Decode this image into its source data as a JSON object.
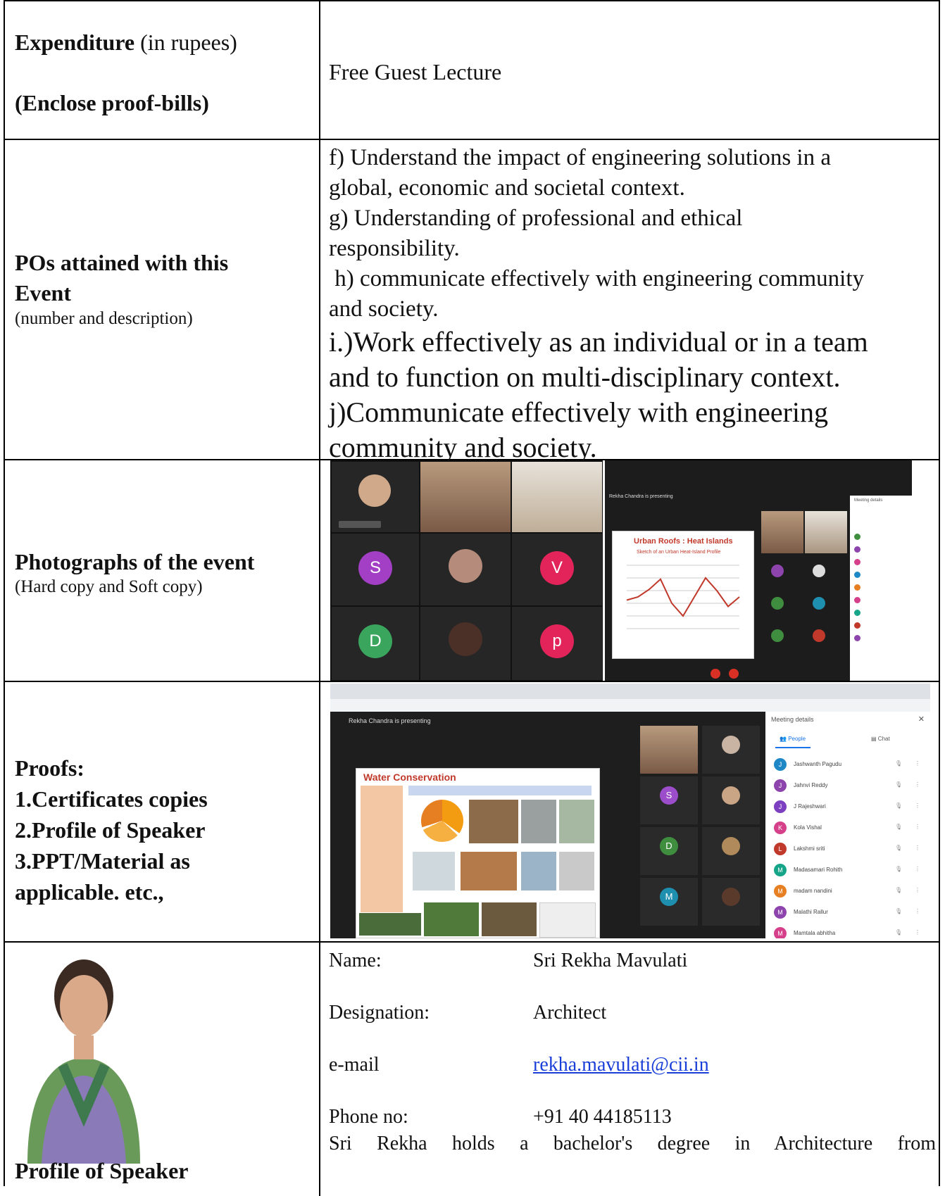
{
  "expenditure": {
    "label_bold": "Expenditure",
    "label_rest": "(in rupees)",
    "label_line2": "(Enclose proof-bills)",
    "value": "Free Guest Lecture"
  },
  "pos": {
    "label_line1": "POs attained with this",
    "label_line2": "Event",
    "label_sub": "(number and description)",
    "items": [
      "f) Understand the impact of engineering solutions in a",
      "global, economic and societal context.",
      "g) Understanding of professional and ethical",
      "responsibility.",
      " h) communicate effectively with engineering community",
      "and society."
    ],
    "items_big": [
      "i.)Work effectively as an individual or in a team",
      "and to function on multi-disciplinary context.",
      "j)Communicate effectively with engineering",
      "community and society."
    ]
  },
  "photos": {
    "label": "Photographs of the event",
    "sub": "(Hard copy and Soft copy)",
    "shot1_avatars": [
      "S",
      "V",
      "D",
      "p"
    ],
    "shot2": {
      "presenting": "Rekha Chandra is presenting",
      "slide_title": "Urban Roofs : Heat Islands",
      "slide_subtitle": "Sketch of an Urban Heat-Island Profile",
      "panel_title": "Meeting details"
    },
    "shot2_curve": [
      0.45,
      0.5,
      0.62,
      0.78,
      0.4,
      0.2,
      0.5,
      0.8,
      0.6,
      0.35,
      0.5
    ]
  },
  "proofs": {
    "title": "Proofs:",
    "items": [
      "1.Certificates copies",
      "2.Profile of Speaker",
      "3.PPT/Material as",
      "applicable. etc.,"
    ],
    "shot": {
      "presenting": "Rekha Chandra is presenting",
      "slide_title": "Water Conservation",
      "panel_title": "Meeting details",
      "people_tab": "People",
      "chat_tab": "Chat",
      "participants": [
        {
          "initial": "J",
          "name": "Jashwanth Pagudu",
          "color": "#1e88c7"
        },
        {
          "initial": "J",
          "name": "Jahnvi Reddy",
          "color": "#8e44ad"
        },
        {
          "initial": "J",
          "name": "J Rajeshwari",
          "color": "#7b3fc0"
        },
        {
          "initial": "K",
          "name": "Kola Vishal",
          "color": "#d6408a"
        },
        {
          "initial": "L",
          "name": "Lakshmi sriti",
          "color": "#c0392b"
        },
        {
          "initial": "M",
          "name": "Madasamari Rohith",
          "color": "#17a589"
        },
        {
          "initial": "M",
          "name": "madam nandini",
          "color": "#e67e22"
        },
        {
          "initial": "M",
          "name": "Malathi Rallur",
          "color": "#8e44ad"
        },
        {
          "initial": "M",
          "name": "Mamtala abhitha",
          "color": "#d6408a"
        }
      ],
      "tiles": [
        {
          "initial": "S",
          "color": "#9b4dca"
        },
        {
          "initial": "D",
          "color": "#3f8e3f"
        },
        {
          "initial": "M",
          "color": "#1e8faf"
        }
      ]
    }
  },
  "speaker": {
    "label": "Profile of Speaker",
    "name_key": "Name:",
    "name_val": "Sri Rekha Mavulati",
    "desig_key": "Designation:",
    "desig_val": "Architect",
    "email_key": "e-mail",
    "email_val": "rekha.mavulati@cii.in",
    "phone_key": "Phone no:",
    "phone_val": "+91 40 44185113",
    "bio": "Sri Rekha holds a bachelor's degree in Architecture from"
  }
}
